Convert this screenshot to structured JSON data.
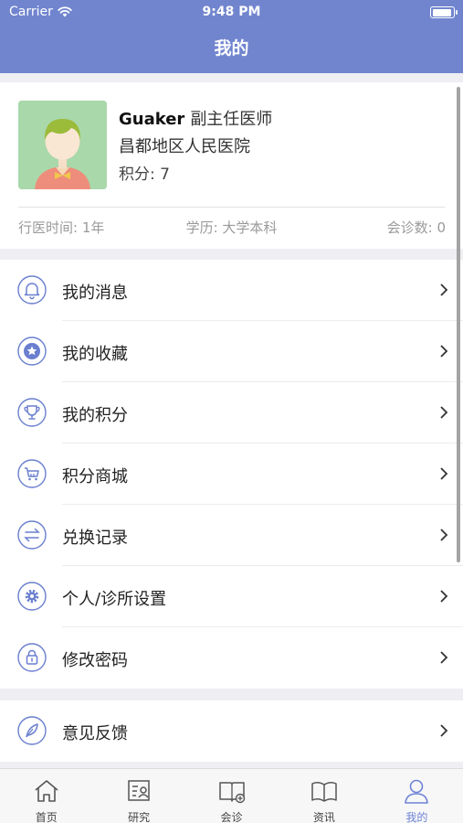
{
  "status_bar": {
    "carrier": "Carrier",
    "time": "9:48 PM"
  },
  "nav": {
    "title": "我的"
  },
  "profile": {
    "name": "Guaker",
    "title": "副主任医师",
    "hospital": "昌都地区人民医院",
    "points": "积分: 7",
    "practice_time": "行医时间: 1年",
    "education": "学历: 大学本科",
    "consult_count": "会诊数: 0"
  },
  "menu": [
    {
      "label": "我的消息",
      "icon": "bell-icon"
    },
    {
      "label": "我的收藏",
      "icon": "star-icon"
    },
    {
      "label": "我的积分",
      "icon": "trophy-icon"
    },
    {
      "label": "积分商城",
      "icon": "cart-icon"
    },
    {
      "label": "兑换记录",
      "icon": "exchange-icon"
    },
    {
      "label": "个人/诊所设置",
      "icon": "gear-icon"
    },
    {
      "label": "修改密码",
      "icon": "lock-icon"
    }
  ],
  "menu2": [
    {
      "label": "意见反馈",
      "icon": "feather-icon"
    }
  ],
  "tabbar": [
    {
      "label": "首页",
      "icon": "home-icon"
    },
    {
      "label": "研究",
      "icon": "research-icon"
    },
    {
      "label": "会诊",
      "icon": "consult-icon"
    },
    {
      "label": "资讯",
      "icon": "book-icon"
    },
    {
      "label": "我的",
      "icon": "user-icon",
      "active": true
    }
  ],
  "colors": {
    "accent": "#7185cf",
    "tab_active": "#6e83d6",
    "icon": "#6a7fcf"
  }
}
